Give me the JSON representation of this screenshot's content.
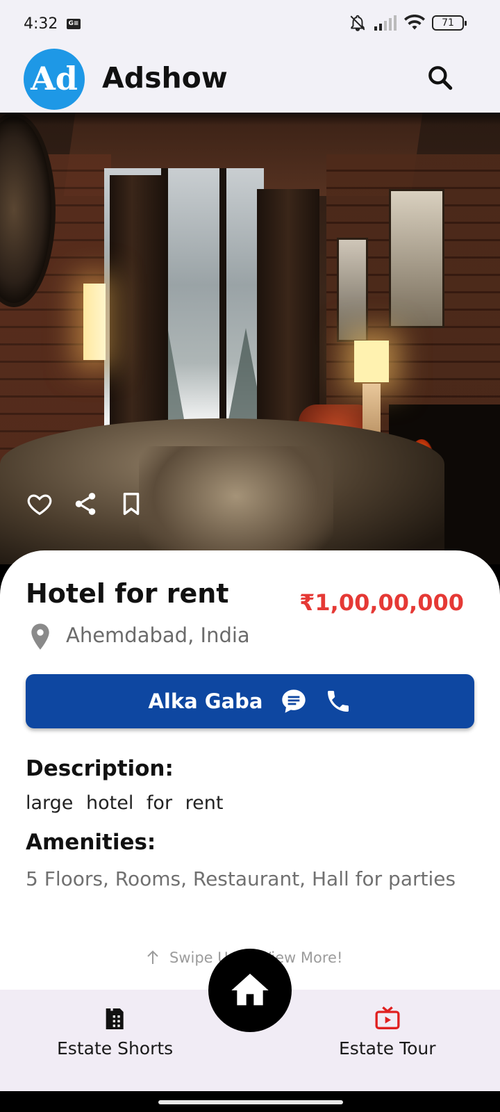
{
  "status_bar": {
    "time": "4:32",
    "battery": "71",
    "sim_icon_label": "G≡"
  },
  "app_bar": {
    "logo_text": "Ad",
    "title": "Adshow",
    "search_icon": "search-icon"
  },
  "listing": {
    "title": "Hotel for rent",
    "price": "₹1,00,00,000",
    "location": "Ahemdabad, India",
    "seller_name": "Alka Gaba",
    "description_heading": "Description:",
    "description": "large hotel for rent",
    "amenities_heading": "Amenities:",
    "amenities": "5 Floors, Rooms, Restaurant, Hall for parties",
    "swipe_hint": "Swipe Up to View More!"
  },
  "hero_actions": [
    "heart-icon",
    "share-icon",
    "bookmark-icon"
  ],
  "bottom_nav": {
    "left_label": "Estate Shorts",
    "right_label": "Estate Tour"
  },
  "colors": {
    "brand_blue": "#1e98e6",
    "contact_button": "#0e47a1",
    "price_red": "#e53935",
    "tour_icon_red": "#e02020"
  }
}
